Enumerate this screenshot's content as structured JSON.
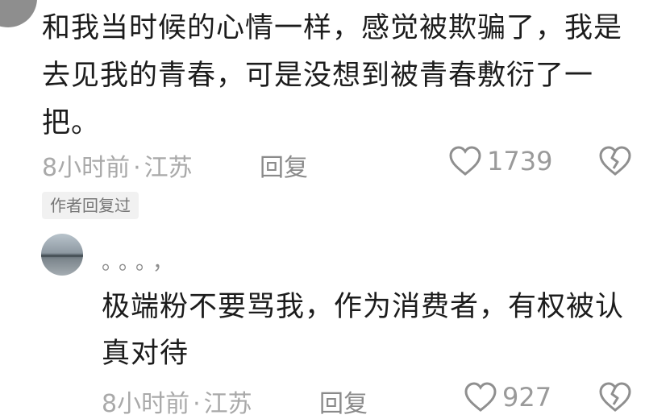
{
  "comment": {
    "text": "和我当时候的心情一样，感觉被欺骗了，我是去见我的青春，可是没想到被青春敷衍了一把。",
    "time": "8小时前",
    "location": "江苏",
    "reply_label": "回复",
    "like_count": "1739",
    "author_badge": "作者回复过"
  },
  "reply": {
    "username": "。。。，",
    "text": "极端粉不要骂我，作为消费者，有权被认真对待",
    "time": "8小时前",
    "location": "江苏",
    "reply_label": "回复",
    "like_count": "927"
  },
  "icons": {
    "like": "heart-outline-icon",
    "dislike": "broken-heart-icon"
  },
  "colors": {
    "text": "#1c1c1c",
    "meta": "#a9a9a9",
    "badge_bg": "#f1f1f1"
  }
}
